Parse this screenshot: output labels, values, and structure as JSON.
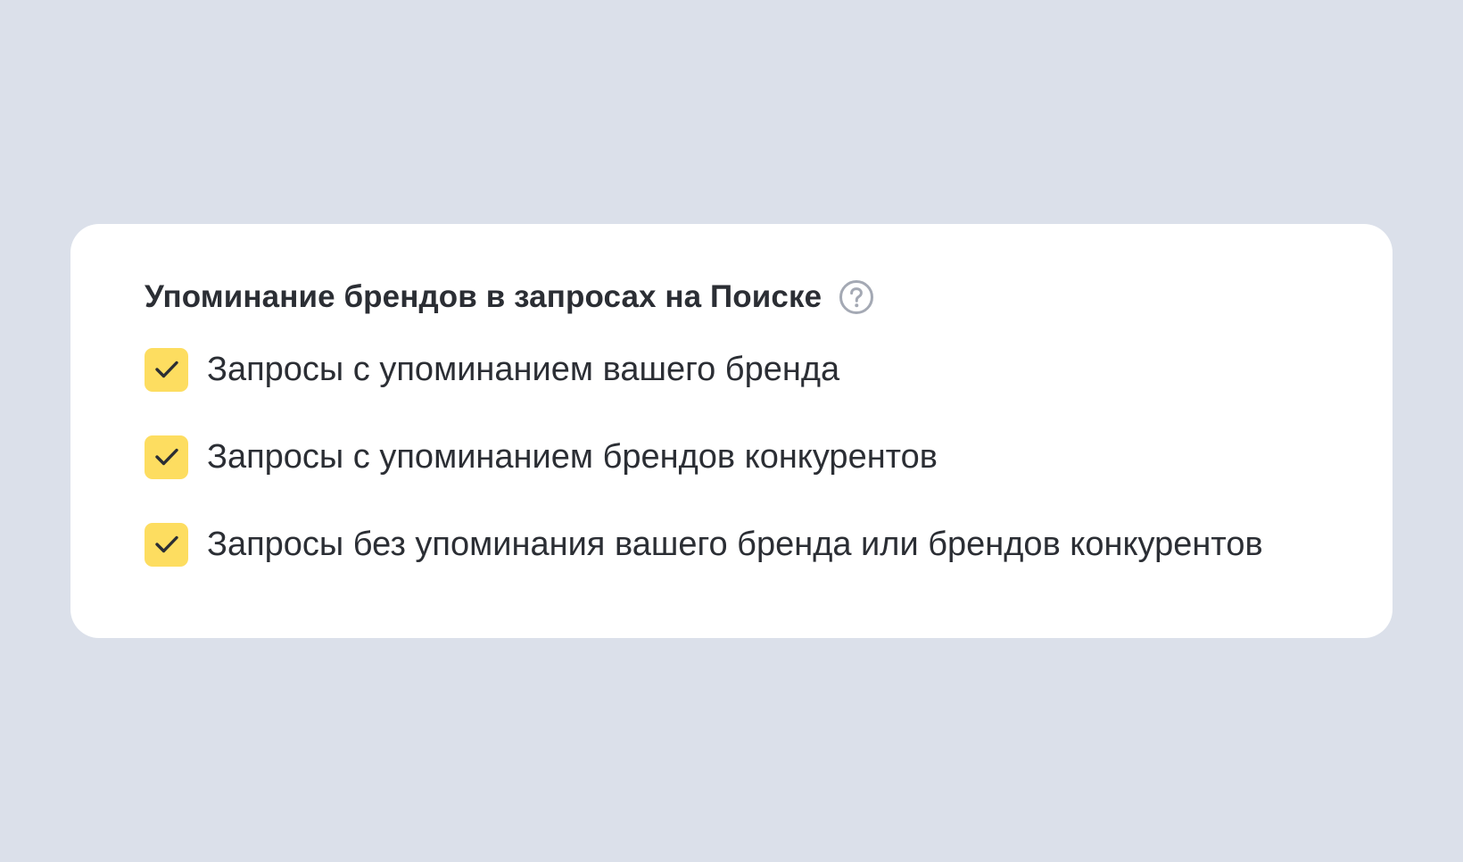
{
  "section": {
    "title": "Упоминание брендов в запросах на Поиске",
    "help_icon": "question-circle-icon"
  },
  "options": [
    {
      "label": "Запросы с упоминанием вашего бренда",
      "checked": true
    },
    {
      "label": "Запросы с упоминанием брендов конкурентов",
      "checked": true
    },
    {
      "label": "Запросы без упоминания вашего бренда или брендов конкурентов",
      "checked": true
    }
  ],
  "colors": {
    "background": "#dbe0ea",
    "card": "#ffffff",
    "checkbox_fill": "#fddd60",
    "check_mark": "#2b2e34",
    "help_icon": "#a4a9b4",
    "text": "#2b2e34"
  }
}
